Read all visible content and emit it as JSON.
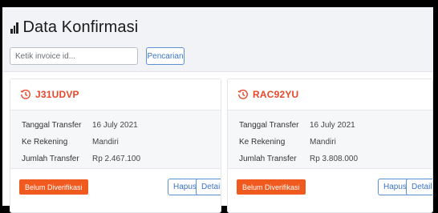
{
  "page": {
    "title": "Data Konfirmasi"
  },
  "search": {
    "placeholder": "Ketik invoice id...",
    "button_label": "Pencarian"
  },
  "cards": [
    {
      "invoice_id": "J31UDVP",
      "rows": [
        {
          "label": "Tanggal Transfer",
          "value": "16 July 2021"
        },
        {
          "label": "Ke Rekening",
          "value": "Mandiri"
        },
        {
          "label": "Jumlah Transfer",
          "value": "Rp 2.467.100"
        }
      ],
      "status_label": "Belum Diverifikasi",
      "delete_label": "Hapus",
      "detail_label": "Detail"
    },
    {
      "invoice_id": "RAC92YU",
      "rows": [
        {
          "label": "Tanggal Transfer",
          "value": "16 July 2021"
        },
        {
          "label": "Ke Rekening",
          "value": "Mandiri"
        },
        {
          "label": "Jumlah Transfer",
          "value": "Rp 3.808.000"
        }
      ],
      "status_label": "Belum Diverifikasi",
      "delete_label": "Hapus",
      "detail_label": "Detail"
    }
  ],
  "colors": {
    "accent": "#e9462a",
    "status_button": "#f15a1f",
    "primary_outline": "#3b73c6"
  }
}
